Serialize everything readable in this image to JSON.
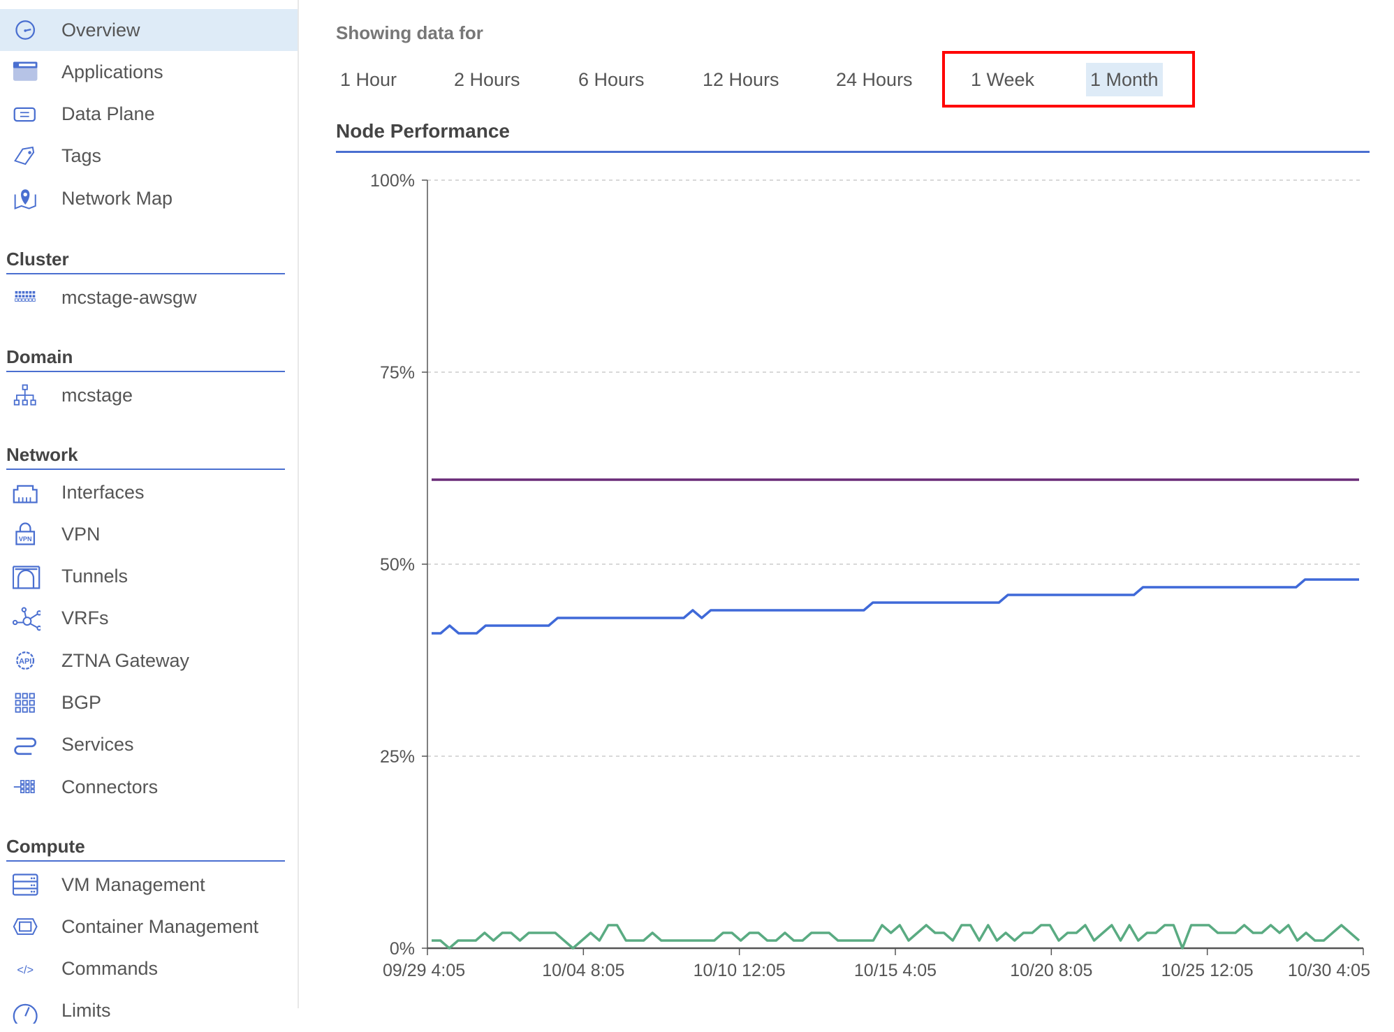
{
  "sidebar": {
    "top_items": [
      {
        "label": "Overview",
        "icon": "gauge-icon",
        "active": true
      },
      {
        "label": "Applications",
        "icon": "window-icon"
      },
      {
        "label": "Data Plane",
        "icon": "data-plane-icon"
      },
      {
        "label": "Tags",
        "icon": "tag-icon"
      },
      {
        "label": "Network Map",
        "icon": "map-pin-icon"
      }
    ],
    "cluster": {
      "heading": "Cluster",
      "items": [
        {
          "label": "mcstage-awsgw",
          "icon": "cluster-grid-icon"
        }
      ]
    },
    "domain": {
      "heading": "Domain",
      "items": [
        {
          "label": "mcstage",
          "icon": "hierarchy-icon"
        }
      ]
    },
    "network": {
      "heading": "Network",
      "items": [
        {
          "label": "Interfaces",
          "icon": "ethernet-port-icon"
        },
        {
          "label": "VPN",
          "icon": "vpn-lock-icon"
        },
        {
          "label": "Tunnels",
          "icon": "tunnel-icon"
        },
        {
          "label": "VRFs",
          "icon": "vrf-nodes-icon"
        },
        {
          "label": "ZTNA Gateway",
          "icon": "api-gear-icon"
        },
        {
          "label": "BGP",
          "icon": "bgp-grid-icon"
        },
        {
          "label": "Services",
          "icon": "services-icon"
        },
        {
          "label": "Connectors",
          "icon": "connectors-icon"
        }
      ]
    },
    "compute": {
      "heading": "Compute",
      "items": [
        {
          "label": "VM Management",
          "icon": "server-icon"
        },
        {
          "label": "Container Management",
          "icon": "container-icon"
        },
        {
          "label": "Commands",
          "icon": "code-icon"
        },
        {
          "label": "Limits",
          "icon": "limits-gauge-icon"
        }
      ]
    }
  },
  "main": {
    "showing_label": "Showing data for",
    "ranges": [
      "1 Hour",
      "2 Hours",
      "6 Hours",
      "12 Hours",
      "24 Hours",
      "1 Week",
      "1 Month"
    ],
    "selected_range": "1 Month",
    "section_title": "Node Performance"
  },
  "colors": {
    "accent": "#4a6fd0",
    "highlight": "#deebf7",
    "annotation": "#ff0000"
  },
  "chart_data": {
    "type": "line",
    "title": "",
    "ylim": [
      0,
      100
    ],
    "y_ticks": [
      "0%",
      "25%",
      "50%",
      "75%",
      "100%"
    ],
    "x_ticks": [
      "09/29 4:05",
      "10/04 8:05",
      "10/10 12:05",
      "10/15 4:05",
      "10/20 8:05",
      "10/25 12:05",
      "10/30 4:05"
    ],
    "grid": "horizontal dashed",
    "series": [
      {
        "color": "#6a2c78",
        "values": [
          61,
          61
        ]
      },
      {
        "color": "#3f69d8",
        "values": [
          41,
          41,
          42,
          41,
          41,
          41,
          42,
          42,
          42,
          42,
          42,
          42,
          42,
          42,
          43,
          43,
          43,
          43,
          43,
          43,
          43,
          43,
          43,
          43,
          43,
          43,
          43,
          43,
          43,
          44,
          43,
          44,
          44,
          44,
          44,
          44,
          44,
          44,
          44,
          44,
          44,
          44,
          44,
          44,
          44,
          44,
          44,
          44,
          44,
          45,
          45,
          45,
          45,
          45,
          45,
          45,
          45,
          45,
          45,
          45,
          45,
          45,
          45,
          45,
          46,
          46,
          46,
          46,
          46,
          46,
          46,
          46,
          46,
          46,
          46,
          46,
          46,
          46,
          46,
          47,
          47,
          47,
          47,
          47,
          47,
          47,
          47,
          47,
          47,
          47,
          47,
          47,
          47,
          47,
          47,
          47,
          47,
          48,
          48,
          48,
          48,
          48,
          48,
          48
        ]
      },
      {
        "color": "#5aab82",
        "values": [
          1,
          1,
          0,
          1,
          1,
          1,
          2,
          1,
          2,
          2,
          1,
          2,
          2,
          2,
          2,
          1,
          0,
          1,
          2,
          1,
          3,
          3,
          1,
          1,
          1,
          2,
          1,
          1,
          1,
          1,
          1,
          1,
          1,
          2,
          2,
          1,
          2,
          2,
          1,
          1,
          2,
          1,
          1,
          2,
          2,
          2,
          1,
          1,
          1,
          1,
          1,
          3,
          2,
          3,
          1,
          2,
          3,
          2,
          2,
          1,
          3,
          3,
          1,
          3,
          1,
          2,
          1,
          2,
          2,
          3,
          3,
          1,
          2,
          2,
          3,
          1,
          2,
          3,
          1,
          3,
          1,
          2,
          2,
          3,
          3,
          0,
          3,
          3,
          3,
          2,
          2,
          2,
          3,
          2,
          2,
          3,
          2,
          3,
          1,
          2,
          1,
          1,
          2,
          3,
          2,
          1
        ]
      }
    ]
  }
}
